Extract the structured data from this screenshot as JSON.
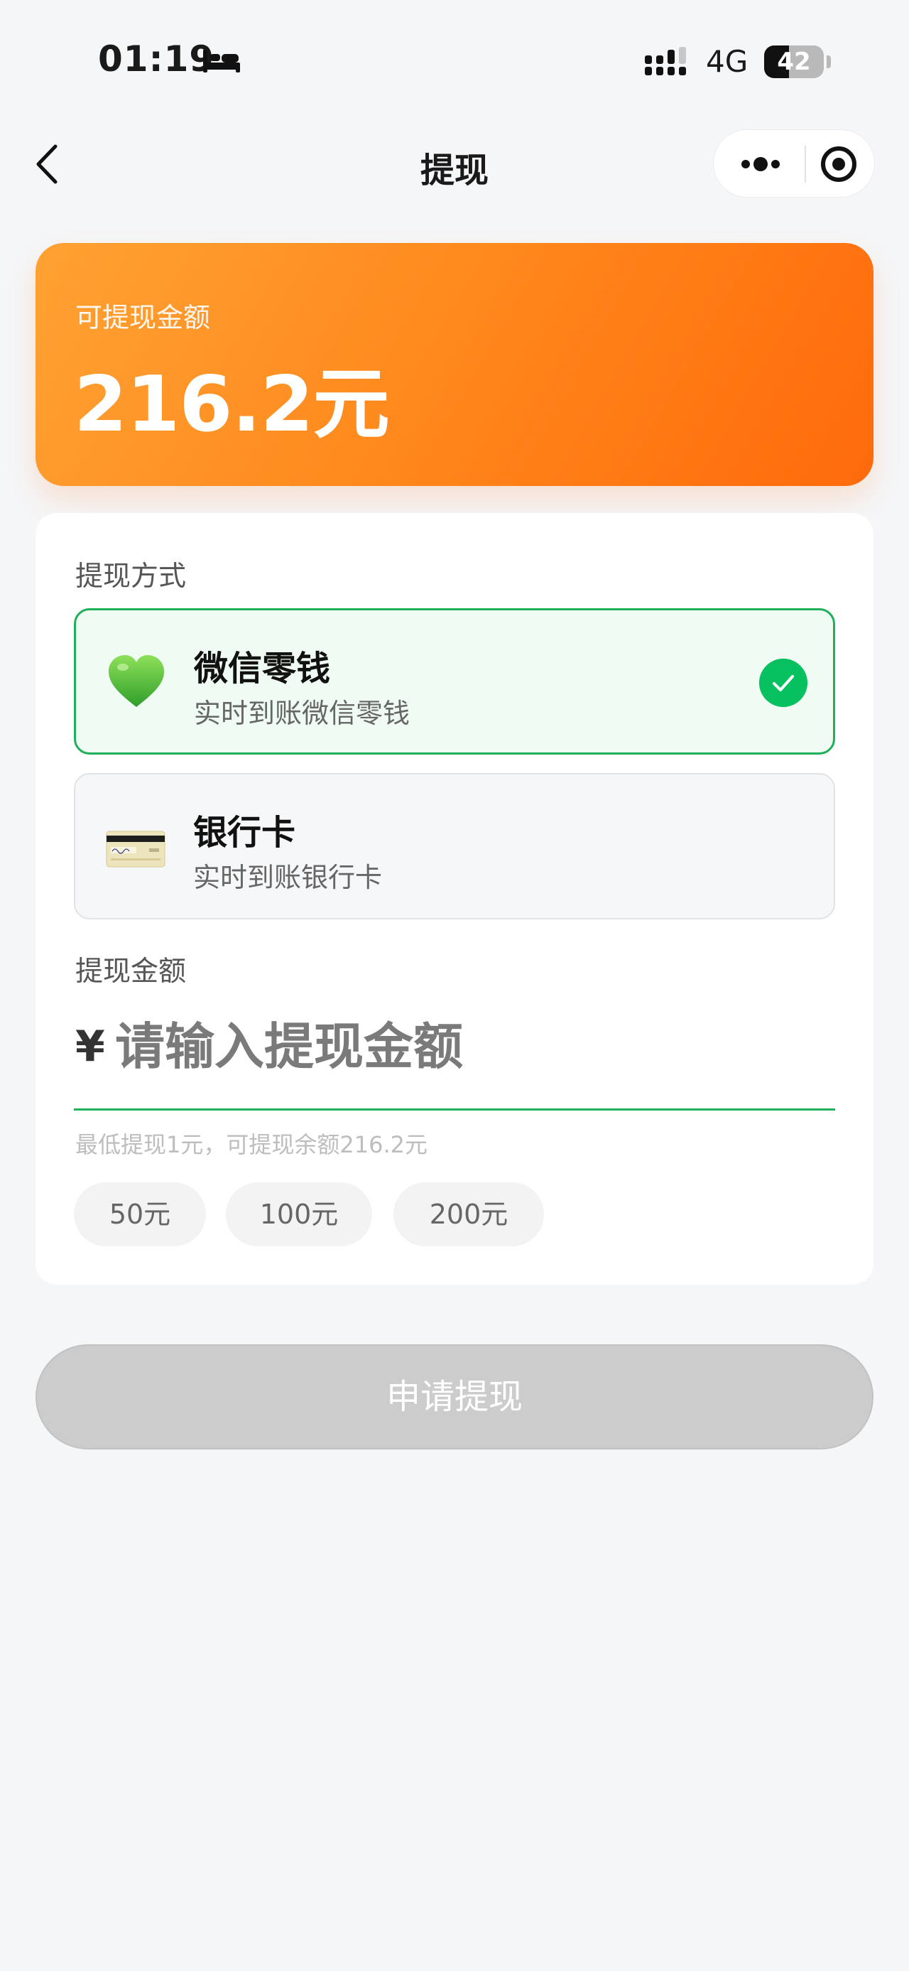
{
  "status_bar": {
    "time": "01:19",
    "network": "4G",
    "battery_level": "42",
    "battery_fraction": 0.42
  },
  "nav": {
    "title": "提现"
  },
  "balance": {
    "label": "可提现金额",
    "amount": "216.2元"
  },
  "withdraw_method": {
    "label": "提现方式",
    "options": [
      {
        "name": "微信零钱",
        "description": "实时到账微信零钱",
        "icon": "green-heart-icon",
        "selected": true
      },
      {
        "name": "银行卡",
        "description": "实时到账银行卡",
        "icon": "bank-card-icon",
        "selected": false
      }
    ]
  },
  "amount_section": {
    "label": "提现金额",
    "currency_symbol": "¥",
    "placeholder": "请输入提现金额",
    "value": "",
    "hint": "最低提现1元，可提现余额216.2元",
    "quick_amounts": [
      "50元",
      "100元",
      "200元"
    ]
  },
  "submit": {
    "label": "申请提现"
  },
  "colors": {
    "accent_orange": "#ff8a1e",
    "wechat_green": "#07c160",
    "disabled_button": "#cccccc"
  }
}
